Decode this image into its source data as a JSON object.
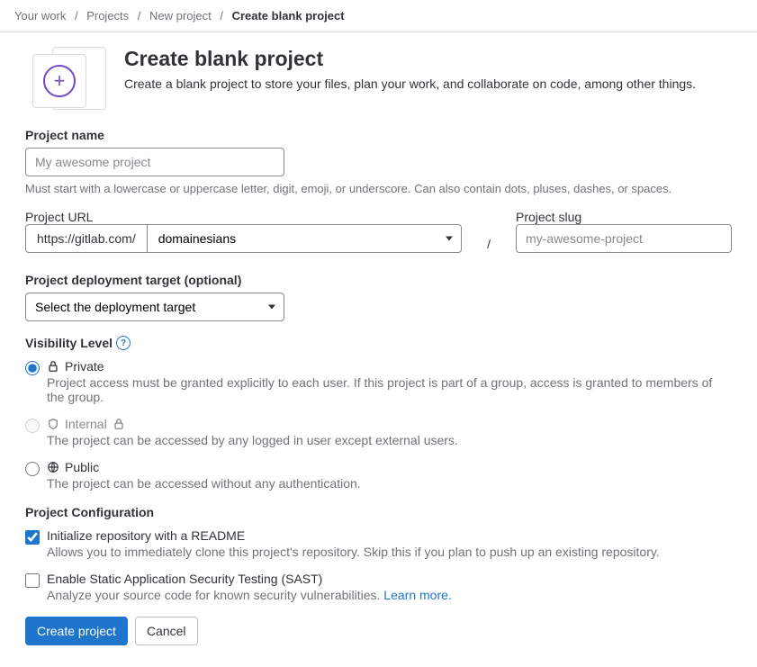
{
  "breadcrumbs": {
    "items": [
      "Your work",
      "Projects",
      "New project"
    ],
    "current": "Create blank project"
  },
  "header": {
    "title": "Create blank project",
    "subtitle": "Create a blank project to store your files, plan your work, and collaborate on code, among other things."
  },
  "project_name": {
    "label": "Project name",
    "placeholder": "My awesome project",
    "value": "",
    "help": "Must start with a lowercase or uppercase letter, digit, emoji, or underscore. Can also contain dots, pluses, dashes, or spaces."
  },
  "project_url": {
    "label": "Project URL",
    "prefix": "https://gitlab.com/",
    "namespace": "domainesians",
    "separator": "/"
  },
  "project_slug": {
    "label": "Project slug",
    "placeholder": "my-awesome-project",
    "value": ""
  },
  "deployment": {
    "label": "Project deployment target (optional)",
    "selected": "Select the deployment target"
  },
  "visibility": {
    "label": "Visibility Level",
    "options": {
      "private": {
        "title": "Private",
        "desc": "Project access must be granted explicitly to each user. If this project is part of a group, access is granted to members of the group."
      },
      "internal": {
        "title": "Internal",
        "desc": "The project can be accessed by any logged in user except external users."
      },
      "public": {
        "title": "Public",
        "desc": "The project can be accessed without any authentication."
      }
    }
  },
  "config": {
    "heading": "Project Configuration",
    "readme": {
      "title": "Initialize repository with a README",
      "desc": "Allows you to immediately clone this project's repository. Skip this if you plan to push up an existing repository."
    },
    "sast": {
      "title": "Enable Static Application Security Testing (SAST)",
      "desc": "Analyze your source code for known security vulnerabilities. ",
      "learn_more": "Learn more."
    }
  },
  "actions": {
    "create": "Create project",
    "cancel": "Cancel"
  }
}
